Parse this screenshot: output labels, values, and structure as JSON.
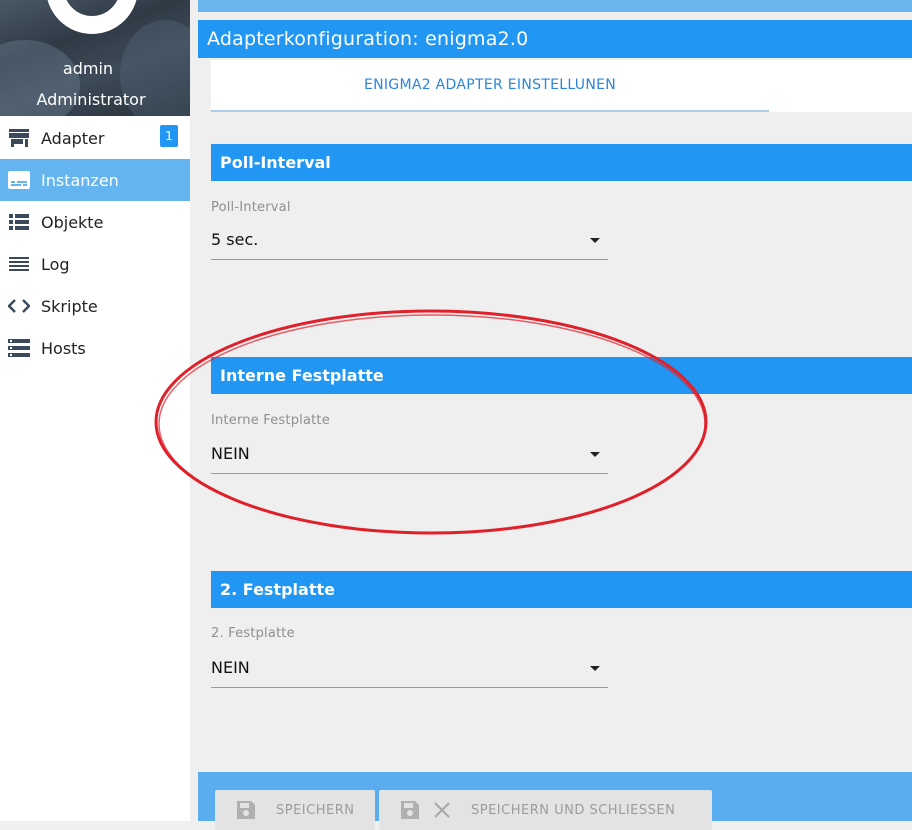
{
  "user": {
    "name": "admin",
    "role": "Administrator"
  },
  "sidebar": {
    "items": [
      {
        "label": "Adapter",
        "icon": "store-icon",
        "badge": "1"
      },
      {
        "label": "Instanzen",
        "icon": "subtitles-icon",
        "active": true
      },
      {
        "label": "Objekte",
        "icon": "list-icon"
      },
      {
        "label": "Log",
        "icon": "lines-icon"
      },
      {
        "label": "Skripte",
        "icon": "code-icon"
      },
      {
        "label": "Hosts",
        "icon": "storage-icon"
      }
    ]
  },
  "main": {
    "title": "Adapterkonfiguration: enigma2.0",
    "tab_label": "ENIGMA2 ADAPTER EINSTELLUNEN",
    "sections": [
      {
        "header": "Poll-Interval",
        "label": "Poll-Interval",
        "value": "5 sec."
      },
      {
        "header": "Interne Festplatte",
        "label": "Interne Festplatte",
        "value": "NEIN"
      },
      {
        "header": "2. Festplatte",
        "label": "2. Festplatte",
        "value": "NEIN"
      }
    ]
  },
  "footer": {
    "save_label": "SPEICHERN",
    "save_close_label": "SPEICHERN UND SCHLIESSEN"
  },
  "colors": {
    "primary": "#2196f3",
    "active_nav": "#64b4ef",
    "annotation": "#e0202a"
  }
}
